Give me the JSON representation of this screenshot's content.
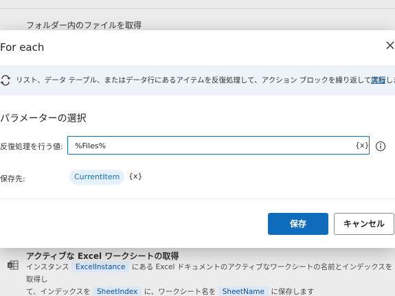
{
  "background": {
    "top_action_title": "フォルダー内のファイルを取得",
    "bottom_action": {
      "title": "アクティブな Excel ワークシートの取得",
      "desc_part1": "インスタンス",
      "chip_instance": "ExcelInstance",
      "desc_part2": "にある Excel ドキュメントのアクティブなワークシートの名前とインデックスを取得し",
      "desc_part3": "て、インデックスを",
      "chip_index": "SheetIndex",
      "desc_part4": "に、ワークシート名を",
      "chip_name": "SheetName",
      "desc_part5": "に保存します"
    }
  },
  "dialog": {
    "title": "For each",
    "banner_text": "リスト、データ テーブル、またはデータ行にあるアイテムを反復処理して、アクション ブロックを繰り返して実行します",
    "banner_link": "詳細",
    "section_title": "パラメーターの選択",
    "iterate_label": "反復処理を行う値:",
    "iterate_value": "%Files%",
    "var_button": "{x}",
    "store_label": "保存先:",
    "store_variable": "CurrentItem",
    "save_label": "保存",
    "cancel_label": "キャンセル"
  },
  "icons": {
    "close": "close-icon",
    "loop": "loop-icon",
    "info": "info-icon",
    "excel": "excel-sheet-icon"
  },
  "colors": {
    "accent": "#0f6cbd",
    "banner_bg": "#eef3fa",
    "chip_bg": "#e6f0fb"
  }
}
